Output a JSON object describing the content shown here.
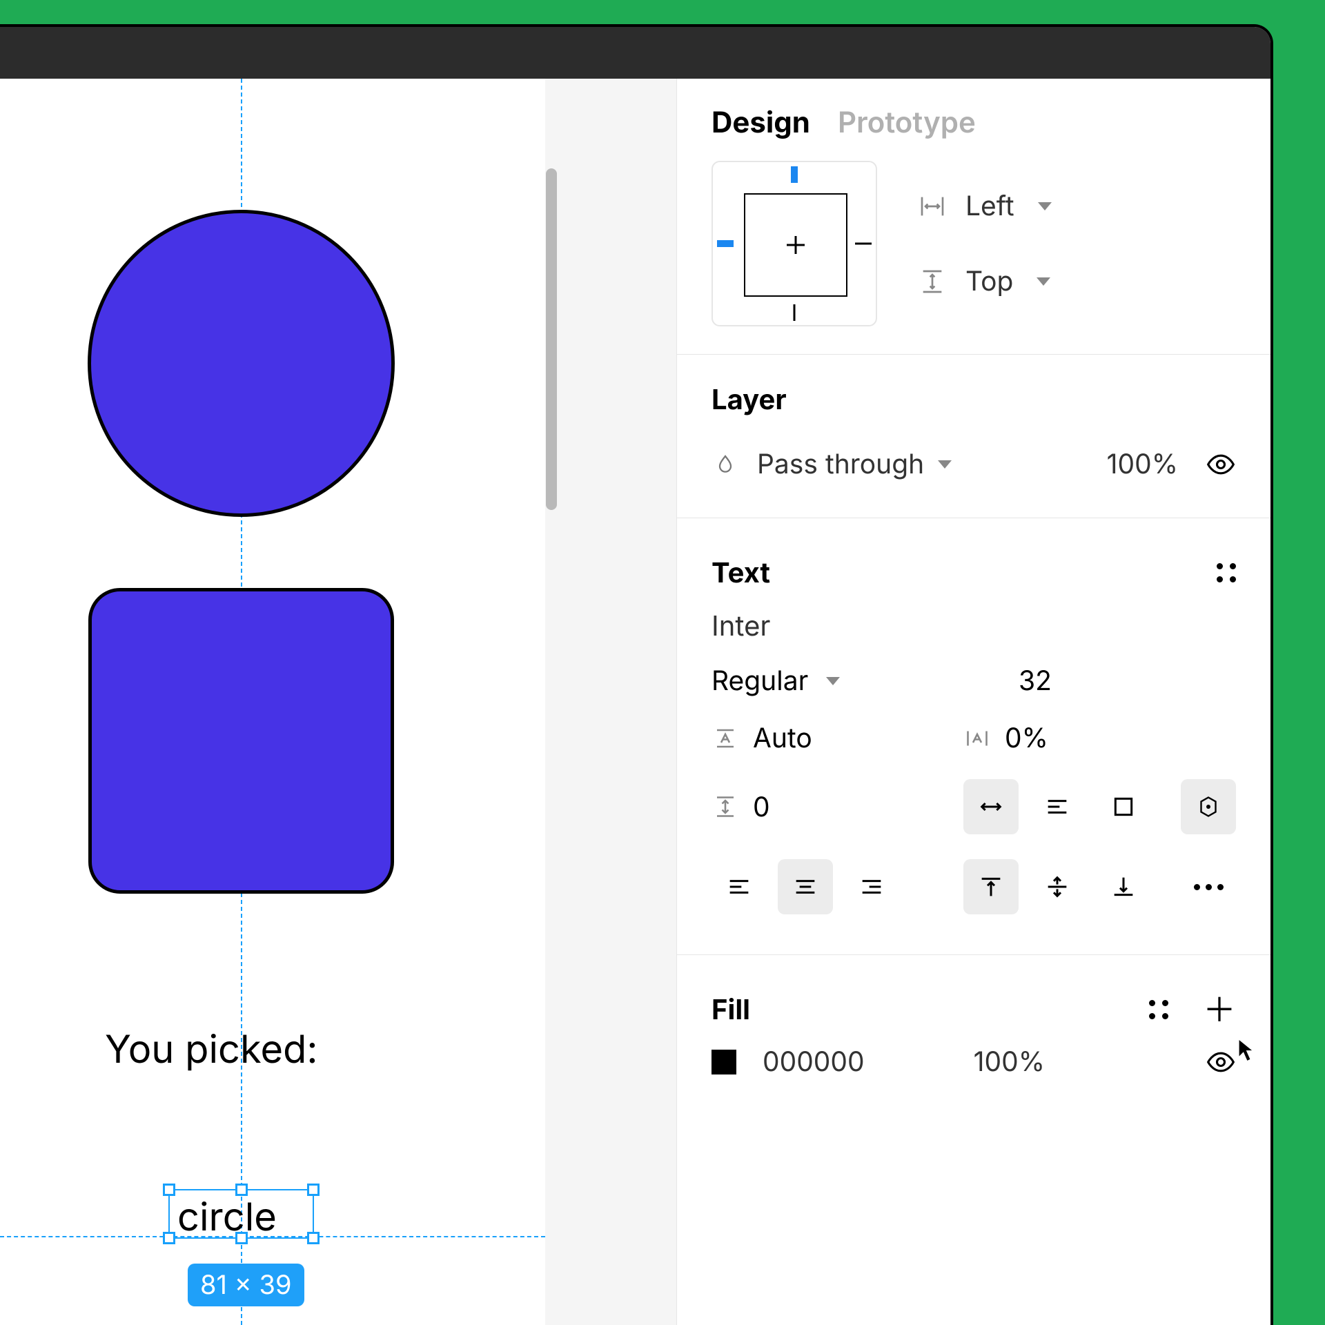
{
  "tabs": {
    "design": "Design",
    "prototype": "Prototype"
  },
  "align": {
    "h": "Left",
    "v": "Top"
  },
  "layer": {
    "title": "Layer",
    "mode": "Pass through",
    "opacity": "100%"
  },
  "text": {
    "title": "Text",
    "font": "Inter",
    "weight": "Regular",
    "size": "32",
    "lineHeight": "Auto",
    "letterSpacing": "0%",
    "paragraphSpacing": "0"
  },
  "fill": {
    "title": "Fill",
    "hex": "000000",
    "opacity": "100%"
  },
  "canvas": {
    "label": "You picked:",
    "selectedText": "circle",
    "sizeBadge": "81 × 39"
  }
}
